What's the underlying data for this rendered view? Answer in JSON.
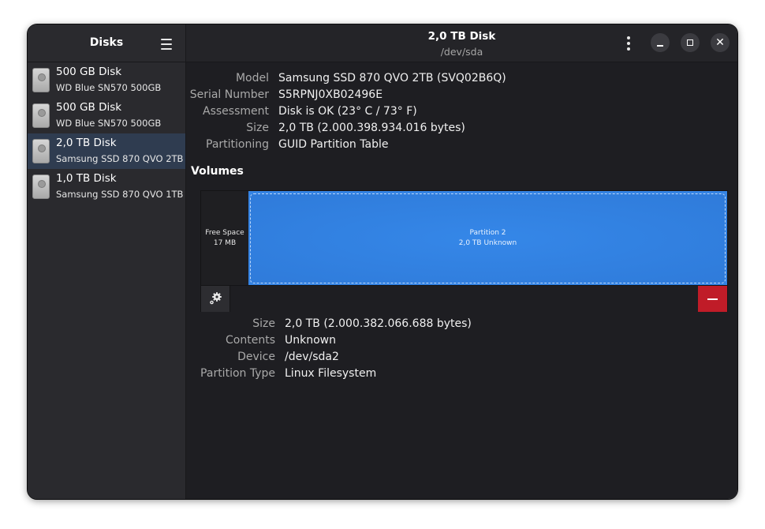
{
  "sidebar": {
    "title": "Disks",
    "menu_icon": "hamburger-icon",
    "disks": [
      {
        "name": "500 GB Disk",
        "model": "WD Blue SN570 500GB",
        "selected": false
      },
      {
        "name": "500 GB Disk",
        "model": "WD Blue SN570 500GB",
        "selected": false
      },
      {
        "name": "2,0 TB Disk",
        "model": "Samsung SSD 870 QVO 2TB",
        "selected": true
      },
      {
        "name": "1,0 TB Disk",
        "model": "Samsung SSD 870 QVO 1TB",
        "selected": false
      }
    ]
  },
  "header": {
    "title": "2,0 TB Disk",
    "subtitle": "/dev/sda"
  },
  "disk_info": [
    {
      "key": "Model",
      "value": "Samsung SSD 870 QVO 2TB (SVQ02B6Q)"
    },
    {
      "key": "Serial Number",
      "value": "S5RPNJ0XB02496E"
    },
    {
      "key": "Assessment",
      "value": "Disk is OK (23° C / 73° F)"
    },
    {
      "key": "Size",
      "value": "2,0 TB (2.000.398.934.016 bytes)"
    },
    {
      "key": "Partitioning",
      "value": "GUID Partition Table"
    }
  ],
  "volumes": {
    "label": "Volumes",
    "free_space": {
      "line1": "Free Space",
      "line2": "17 MB"
    },
    "partition": {
      "line1": "Partition 2",
      "line2": "2,0 TB Unknown"
    }
  },
  "partition_info": [
    {
      "key": "Size",
      "value": "2,0 TB (2.000.382.066.688 bytes)"
    },
    {
      "key": "Contents",
      "value": "Unknown"
    },
    {
      "key": "Device",
      "value": "/dev/sda2"
    },
    {
      "key": "Partition Type",
      "value": "Linux Filesystem"
    }
  ],
  "colors": {
    "accent": "#3584e4",
    "destructive": "#c01c28",
    "selected_row": "#2f3c50"
  }
}
